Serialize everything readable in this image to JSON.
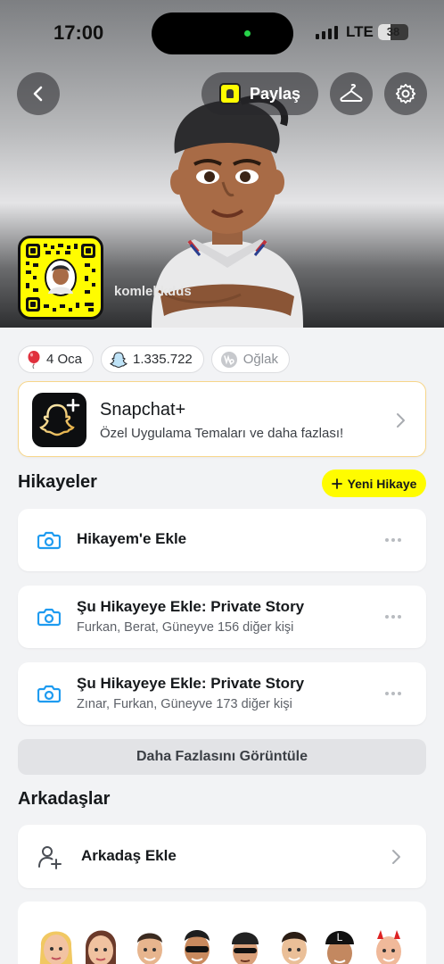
{
  "status_bar": {
    "time": "17:00",
    "network": "LTE",
    "battery": "38"
  },
  "header": {
    "share_label": "Paylaş"
  },
  "profile": {
    "username": "komlekkdds"
  },
  "chips": [
    {
      "icon": "balloon-icon",
      "label": "4 Oca"
    },
    {
      "icon": "snap-score-icon",
      "label": "1.335.722"
    },
    {
      "icon": "capricorn-icon",
      "label": "Oğlak"
    }
  ],
  "snapchat_plus": {
    "title": "Snapchat+",
    "subtitle": "Özel Uygulama Temaları ve daha fazlası!"
  },
  "stories": {
    "title": "Hikayeler",
    "new_story_label": "Yeni Hikaye",
    "items": [
      {
        "title": "Hikayem'e Ekle",
        "subtitle": ""
      },
      {
        "title": "Şu Hikayeye Ekle: Private Story",
        "subtitle": "Furkan, Berat, Güneyve 156 diğer kişi"
      },
      {
        "title": "Şu Hikayeye Ekle: Private Story",
        "subtitle": "Zınar, Furkan, Güneyve 173 diğer kişi"
      }
    ],
    "more_label": "Daha Fazlasını Görüntüle"
  },
  "friends": {
    "title": "Arkadaşlar",
    "add_label": "Arkadaş Ekle"
  },
  "colors": {
    "snap_yellow": "#fffc00",
    "blue_icon": "#1e9bf0",
    "plus_border": "#f7d68a"
  }
}
